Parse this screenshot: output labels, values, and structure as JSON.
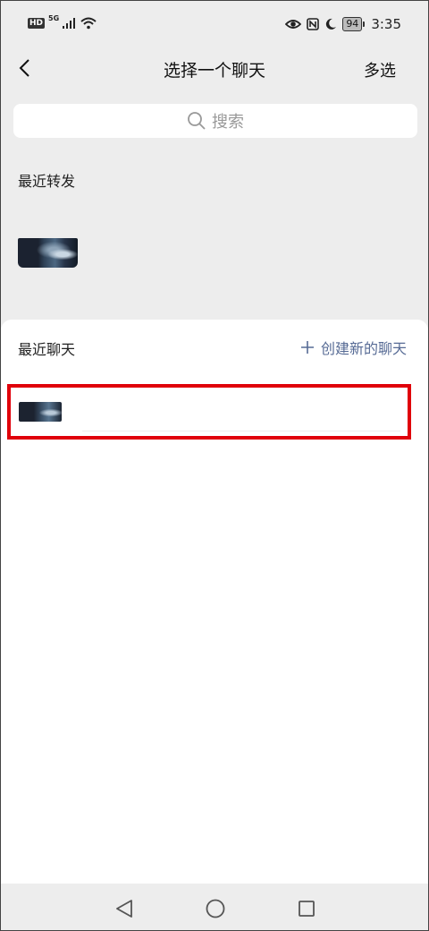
{
  "status_bar": {
    "hd": "HD",
    "network": "5G",
    "battery": "94",
    "time": "3:35"
  },
  "header": {
    "title": "选择一个聊天",
    "multi_select": "多选"
  },
  "search": {
    "placeholder": "搜索"
  },
  "recent_forward": {
    "title": "最近转发"
  },
  "recent_chats": {
    "title": "最近聊天",
    "create_new": "创建新的聊天"
  },
  "icons": {
    "back": "chevron-left-icon",
    "search": "search-icon",
    "plus": "plus-icon",
    "nav_back": "triangle-back-icon",
    "nav_home": "circle-home-icon",
    "nav_recents": "square-recents-icon"
  },
  "colors": {
    "link": "#576b95",
    "highlight_border": "#e0000a",
    "background": "#ededed"
  }
}
